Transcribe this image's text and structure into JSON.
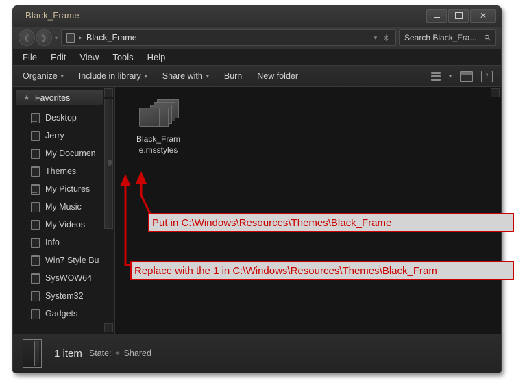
{
  "window": {
    "title": "Black_Frame",
    "controls": {
      "minimize": "minimize-button",
      "maximize": "maximize-button",
      "close": "close-button",
      "close_glyph": "✕"
    }
  },
  "address_bar": {
    "back_glyph": "❮",
    "forward_glyph": "❯",
    "history_caret": "▾",
    "separator": "▸",
    "breadcrumb": "Black_Frame",
    "dropdown_caret": "▾",
    "refresh_glyph": "✳"
  },
  "search": {
    "value": "Search Black_Fra...",
    "placeholder": "Search Black_Frame",
    "icon_glyph": "⚲"
  },
  "menubar": {
    "items": [
      {
        "label": "File"
      },
      {
        "label": "Edit"
      },
      {
        "label": "View"
      },
      {
        "label": "Tools"
      },
      {
        "label": "Help"
      }
    ]
  },
  "toolbar": {
    "items": [
      {
        "label": "Organize",
        "caret": "▾"
      },
      {
        "label": "Include in library",
        "caret": "▾"
      },
      {
        "label": "Share with",
        "caret": "▾"
      },
      {
        "label": "Burn",
        "caret": ""
      },
      {
        "label": "New folder",
        "caret": ""
      }
    ],
    "view_caret": "▾",
    "help_glyph": "?"
  },
  "sidebar": {
    "header": {
      "label": "Favorites",
      "icon_glyph": "★"
    },
    "items": [
      {
        "label": "Desktop"
      },
      {
        "label": "Jerry"
      },
      {
        "label": "My Documen"
      },
      {
        "label": "Themes"
      },
      {
        "label": "My Pictures"
      },
      {
        "label": "My Music"
      },
      {
        "label": "My Videos"
      },
      {
        "label": "Info"
      },
      {
        "label": "Win7 Style Bu"
      },
      {
        "label": "SysWOW64"
      },
      {
        "label": "System32"
      },
      {
        "label": "Gadgets"
      }
    ]
  },
  "file_pane": {
    "items": [
      {
        "name": "Black_Frame.msstyles",
        "icon": "msstyles-stack-icon"
      }
    ]
  },
  "status_bar": {
    "count": "1 item",
    "state_label": "State:",
    "share_glyph": "⚭",
    "share_label": "Shared",
    "folder_icon": "open-folder-icon"
  },
  "annotations": [
    {
      "id": "put",
      "text": "Put in C:\\Windows\\Resources\\Themes\\Black_Frame"
    },
    {
      "id": "replace",
      "text": "Replace with the 1 in C:\\Windows\\Resources\\Themes\\Black_Fram"
    }
  ],
  "colors": {
    "annotation_red": "#cc0000",
    "annotation_fill": "#d4d4d4",
    "window_bg": "#242424",
    "pane_bg": "#151515",
    "title_text": "#c8b89a"
  }
}
